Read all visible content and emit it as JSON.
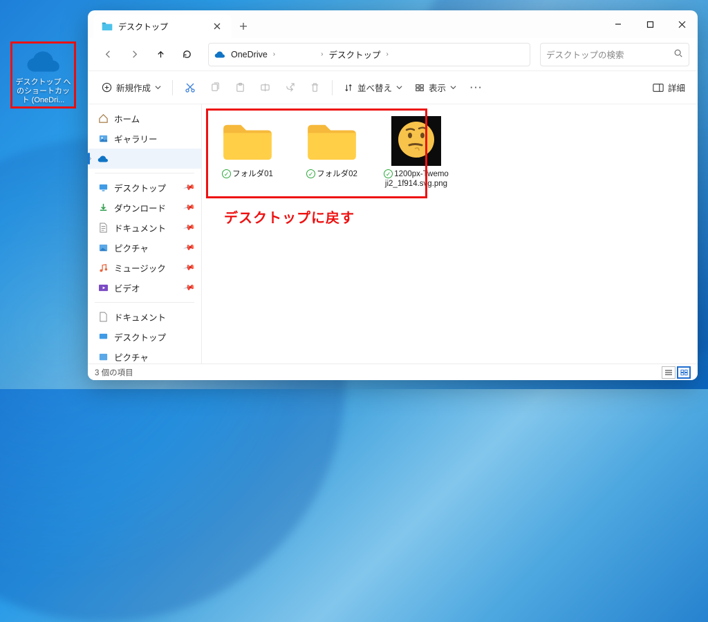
{
  "desktop": {
    "shortcut_label": "デスクトップ へのショートカット (OneDri..."
  },
  "window": {
    "tab_title": "デスクトップ"
  },
  "breadcrumb": {
    "root": "OneDrive",
    "mid": "　　　　",
    "leaf": "デスクトップ"
  },
  "search": {
    "placeholder": "デスクトップの検索"
  },
  "commands": {
    "new": "新規作成",
    "sort": "並べ替え",
    "view": "表示",
    "details": "詳細"
  },
  "sidebar": {
    "home": "ホーム",
    "gallery": "ギャラリー",
    "onedrive_blur": "　　　",
    "desktop": "デスクトップ",
    "downloads": "ダウンロード",
    "documents": "ドキュメント",
    "pictures": "ピクチャ",
    "music": "ミュージック",
    "videos": "ビデオ",
    "documents2": "ドキュメント",
    "desktop2": "デスクトップ",
    "pictures2": "ピクチャ"
  },
  "items": [
    {
      "name": "フォルダ01",
      "type": "folder"
    },
    {
      "name": "フォルダ02",
      "type": "folder"
    },
    {
      "name": "1200px-Twemoji2_1f914.svg.png",
      "type": "image"
    }
  ],
  "annotation": "デスクトップに戻す",
  "status": {
    "count_label": "3 個の項目"
  }
}
